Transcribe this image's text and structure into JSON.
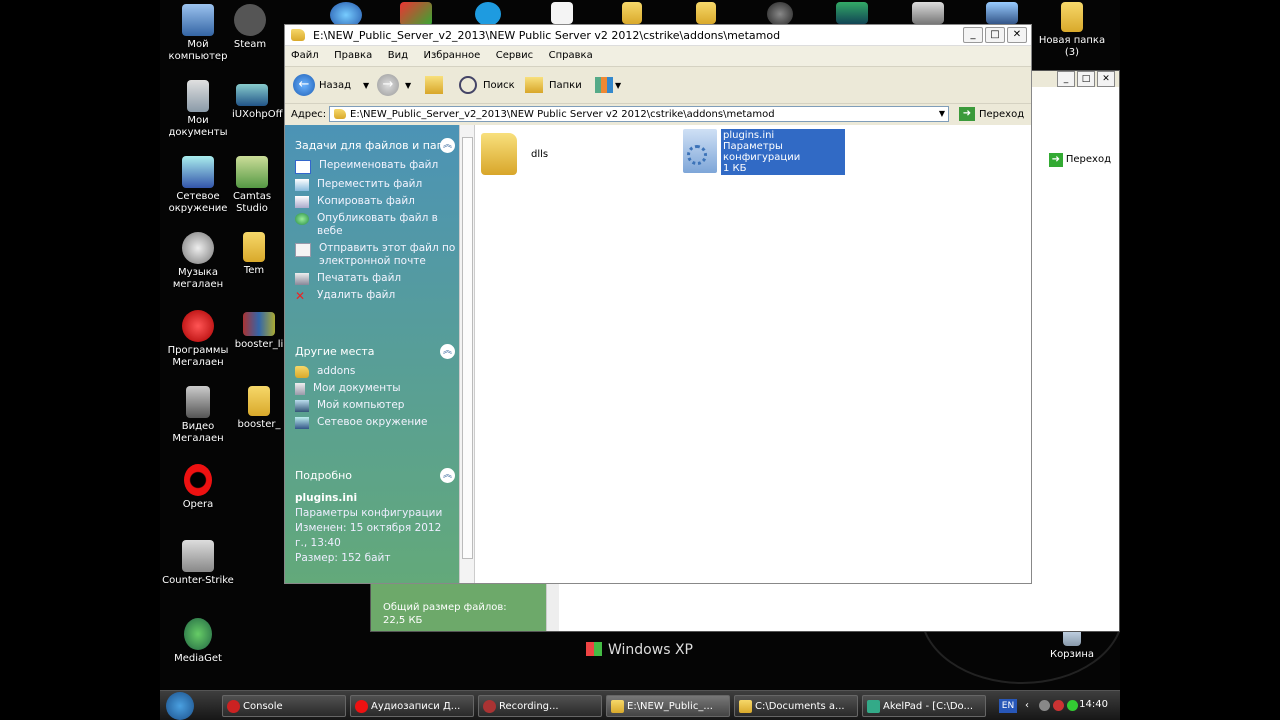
{
  "desktop": {
    "icons": [
      {
        "label": "Мой компьютер"
      },
      {
        "label": "Steam"
      },
      {
        "label": "Мои документы"
      },
      {
        "label": "iUXohpOff"
      },
      {
        "label": "Сетевое окружение"
      },
      {
        "label": "Camtas Studio"
      },
      {
        "label": "Музыка мегалаен"
      },
      {
        "label": "Tem"
      },
      {
        "label": "Программы Мегалаен"
      },
      {
        "label": "booster_li"
      },
      {
        "label": "Видео Мегалаен"
      },
      {
        "label": "booster_"
      },
      {
        "label": "Opera"
      },
      {
        "label": "Counter-Strike"
      },
      {
        "label": "MediaGet"
      },
      {
        "label": "Новая папка (3)"
      },
      {
        "label": "Корзина"
      }
    ],
    "watermark": "Windows XP"
  },
  "background_window": {
    "go_label": "Переход",
    "total_size_label": "Общий размер файлов:",
    "total_size_value": "22,5 КБ"
  },
  "window": {
    "title": "E:\\NEW_Public_Server_v2_2013\\NEW Public Server v2 2012\\cstrike\\addons\\metamod",
    "menu": [
      "Файл",
      "Правка",
      "Вид",
      "Избранное",
      "Сервис",
      "Справка"
    ],
    "toolbar": {
      "back": "Назад",
      "search": "Поиск",
      "folders": "Папки"
    },
    "address": {
      "label": "Адрес:",
      "value": "E:\\NEW_Public_Server_v2_2013\\NEW Public Server v2 2012\\cstrike\\addons\\metamod",
      "go": "Переход"
    },
    "tasks": {
      "title": "Задачи для файлов и пап",
      "items": [
        {
          "label": "Переименовать файл"
        },
        {
          "label": "Переместить файл"
        },
        {
          "label": "Копировать файл"
        },
        {
          "label": "Опубликовать файл в вебе"
        },
        {
          "label": "Отправить этот файл по электронной почте"
        },
        {
          "label": "Печатать файл"
        },
        {
          "label": "Удалить файл"
        }
      ]
    },
    "places": {
      "title": "Другие места",
      "items": [
        {
          "label": "addons"
        },
        {
          "label": "Мои документы"
        },
        {
          "label": "Мой компьютер"
        },
        {
          "label": "Сетевое окружение"
        }
      ]
    },
    "details": {
      "title": "Подробно",
      "name": "plugins.ini",
      "type": "Параметры конфигурации",
      "modified": "Изменен: 15 октября 2012 г., 13:40",
      "size": "Размер: 152 байт"
    },
    "files": [
      {
        "name": "dlls"
      },
      {
        "name": "plugins.ini",
        "type": "Параметры конфигурации",
        "size": "1 КБ"
      }
    ]
  },
  "taskbar": {
    "buttons": [
      {
        "label": "Console"
      },
      {
        "label": "Аудиозаписи Д..."
      },
      {
        "label": "Recording..."
      },
      {
        "label": "E:\\NEW_Public_..."
      },
      {
        "label": "C:\\Documents a..."
      },
      {
        "label": "AkelPad - [C:\\Do..."
      }
    ],
    "lang": "EN",
    "clock": "14:40"
  },
  "colors": {
    "selection": "#316ac5",
    "task_pane_top": "#4c93b6",
    "task_pane_bottom": "#63a97a"
  }
}
